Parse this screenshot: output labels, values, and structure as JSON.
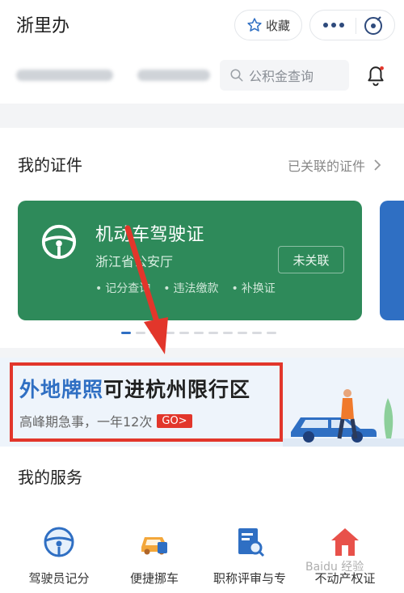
{
  "app": {
    "title": "浙里办"
  },
  "toolbar": {
    "favorite_label": "收藏"
  },
  "search": {
    "placeholder": "公积金查询"
  },
  "certificates": {
    "title": "我的证件",
    "link_label": "已关联的证件",
    "card": {
      "name": "机动车驾驶证",
      "issuer": "浙江省公安厅",
      "status": "未关联",
      "features": [
        "记分查询",
        "违法缴款",
        "补换证"
      ],
      "color": "#2e8a5a"
    }
  },
  "banner": {
    "headline_highlight": "外地牌照",
    "headline_rest": "可进杭州限行区",
    "subtitle": "高峰期急事，一年12次",
    "go_label": "GO>"
  },
  "services": {
    "title": "我的服务",
    "items": [
      {
        "label": "驾驶员记分",
        "icon": "steering-wheel-icon"
      },
      {
        "label": "便捷挪车",
        "icon": "car-icon"
      },
      {
        "label": "职称评审与专",
        "icon": "document-search-icon"
      },
      {
        "label": "不动产权证",
        "icon": "house-icon"
      }
    ]
  },
  "watermark": {
    "text": "Baidu 经验"
  },
  "colors": {
    "accent_blue": "#2f6fc3",
    "highlight_red": "#e2362b",
    "card_green": "#2e8a5a"
  }
}
